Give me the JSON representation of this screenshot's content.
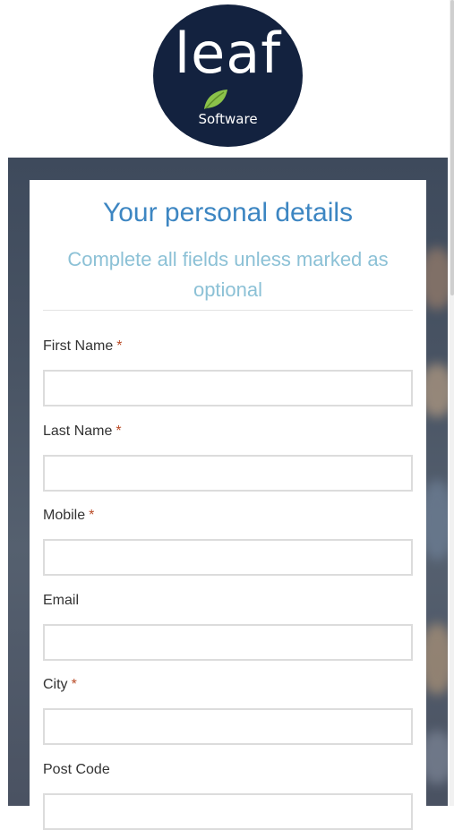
{
  "brand": {
    "logo_word": "leaf",
    "logo_subtitle": "Software",
    "colors": {
      "navy": "#13223f",
      "leaf_green": "#8bc34a"
    }
  },
  "form": {
    "title": "Your personal details",
    "subtitle": "Complete all fields unless marked as optional",
    "required_marker": "*",
    "fields": [
      {
        "label": "First Name",
        "value": ""
      },
      {
        "label": "Last Name",
        "value": ""
      },
      {
        "label": "Mobile",
        "value": ""
      },
      {
        "label": "Email",
        "value": ""
      },
      {
        "label": "City",
        "value": ""
      },
      {
        "label": "Post Code",
        "value": ""
      }
    ]
  },
  "colors": {
    "title": "#3d86c2",
    "subtitle": "#8cc1d6",
    "required_marker": "#b94a26",
    "input_border": "#dcdcdc"
  }
}
